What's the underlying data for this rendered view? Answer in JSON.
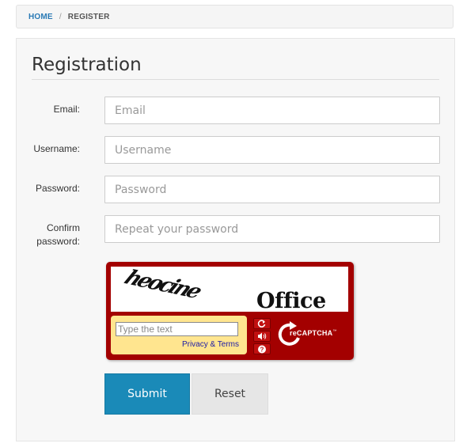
{
  "breadcrumb": {
    "home": "HOME",
    "separator": "/",
    "current": "REGISTER"
  },
  "form": {
    "title": "Registration",
    "fields": [
      {
        "label": "Email:",
        "placeholder": "Email",
        "value": ""
      },
      {
        "label": "Username:",
        "placeholder": "Username",
        "value": ""
      },
      {
        "label": "Password:",
        "placeholder": "Password",
        "value": ""
      },
      {
        "label_line1": "Confirm",
        "label_line2": "password:",
        "placeholder": "Repeat your password",
        "value": ""
      }
    ],
    "captcha": {
      "word1": "heocine",
      "word2": "Office",
      "input_placeholder": "Type the text",
      "links": "Privacy & Terms",
      "brand_prefix": "re",
      "brand": "CAPTCHA",
      "trademark": "™",
      "icons": [
        "refresh-icon",
        "audio-icon",
        "help-icon",
        "recaptcha-logo-icon"
      ]
    },
    "buttons": {
      "submit": "Submit",
      "reset": "Reset"
    }
  },
  "colors": {
    "link": "#2a7ab5",
    "submit": "#1a8ab8",
    "captcha_frame": "#a30000",
    "captcha_box": "#ffe58f"
  }
}
